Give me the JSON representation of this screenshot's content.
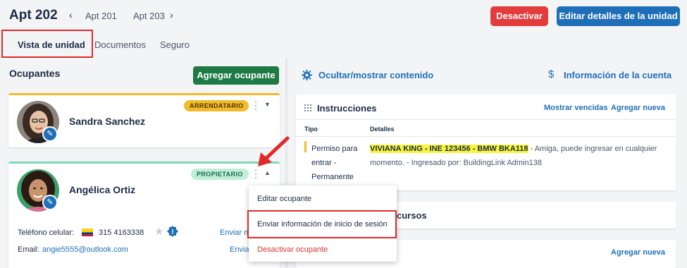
{
  "header": {
    "title": "Apt 202",
    "prev_unit": "Apt 201",
    "next_unit": "Apt 203",
    "deactivate_label": "Desactivar",
    "edit_unit_label": "Editar detalles de la unidad"
  },
  "tabs": [
    {
      "label": "Vista de unidad",
      "active": true
    },
    {
      "label": "Documentos"
    },
    {
      "label": "Seguro"
    }
  ],
  "occupants": {
    "title": "Ocupantes",
    "add_label": "Agregar ocupante",
    "list": [
      {
        "name": "Sandra Sanchez",
        "role": "ARRENDATARIO"
      },
      {
        "name": "Angélica Ortiz",
        "role": "PROPIETARIO",
        "phone_label": "Teléfono celular:",
        "phone": "315 4163338",
        "phone_action": "Enviar m",
        "email_label": "Email:",
        "email": "angie5555@outlook.com",
        "email_action": "Enviar"
      }
    ]
  },
  "right": {
    "toggle_label": "Ocultar/mostrar contenido",
    "account_label": "Información de la cuenta",
    "instructions": {
      "title": "Instrucciones",
      "show_expired": "Mostrar vencidas",
      "add_new": "Agregar nueva",
      "col_tipo": "Tipo",
      "col_detalles": "Detalles",
      "row": {
        "tipo": "Permiso para entrar - Permanente",
        "highlight": "VIVIANA KING - INE 123456 - BMW BKA118",
        "detail": " - Amiga, puede ingresar en cualquier momento.  - Ingresado por: BuildingLink Admin138"
      }
    },
    "resources_fragment": "cursos",
    "add_new_bottom": "Agregar nueva"
  },
  "menu": {
    "edit": "Editar ocupante",
    "send_login": "Enviar información de inicio de sesión",
    "deactivate": "Desactivar ocupante"
  },
  "colors": {
    "primary": "#1f6fb8",
    "danger": "#e33c3c",
    "success": "#1d7a45",
    "tenant_badge": "#f2bb2c",
    "owner_badge": "#bfeed9",
    "annotation": "#e02a2a"
  }
}
